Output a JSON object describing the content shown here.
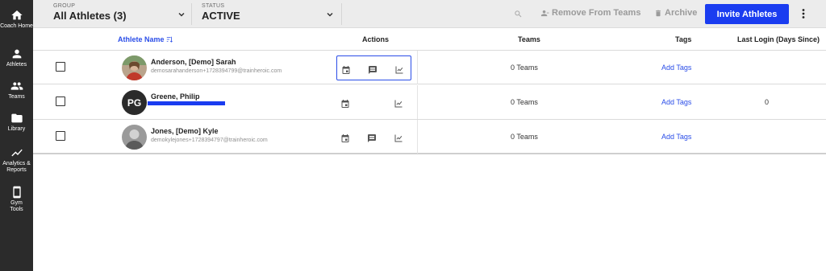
{
  "sidebar": {
    "items": [
      {
        "label": "Coach Home",
        "icon": "home-icon"
      },
      {
        "label": "Athletes",
        "icon": "person-icon"
      },
      {
        "label": "Teams",
        "icon": "group-icon"
      },
      {
        "label": "Library",
        "icon": "folder-icon"
      },
      {
        "label": "Analytics & Reports",
        "icon": "trend-icon"
      },
      {
        "label": "Gym Tools",
        "icon": "tablet-icon"
      }
    ]
  },
  "toolbar": {
    "group_caption": "GROUP",
    "group_value": "All Athletes (3)",
    "status_caption": "STATUS",
    "status_value": "ACTIVE",
    "remove_label": "Remove From Teams",
    "archive_label": "Archive",
    "invite_label": "Invite Athletes"
  },
  "table": {
    "headers": {
      "athlete_name": "Athlete Name",
      "actions": "Actions",
      "teams": "Teams",
      "tags": "Tags",
      "last_login": "Last Login (Days Since)"
    },
    "rows": [
      {
        "name": "Anderson, [Demo] Sarah",
        "email": "demosarahanderson+1728394799@trainheroic.com",
        "teams": "0 Teams",
        "tags_link": "Add Tags",
        "last_login": "",
        "initials": ""
      },
      {
        "name": "Greene, Philip",
        "email": "",
        "teams": "0 Teams",
        "tags_link": "Add Tags",
        "last_login": "0",
        "initials": "PG"
      },
      {
        "name": "Jones, [Demo] Kyle",
        "email": "demokylejones+1728394797@trainheroic.com",
        "teams": "0 Teams",
        "tags_link": "Add Tags",
        "last_login": "",
        "initials": ""
      }
    ]
  },
  "colors": {
    "sidebar_bg": "#2b2b2b",
    "accent": "#1a3cf0",
    "link": "#2a4de8",
    "toolbar_bg": "#ececec"
  }
}
